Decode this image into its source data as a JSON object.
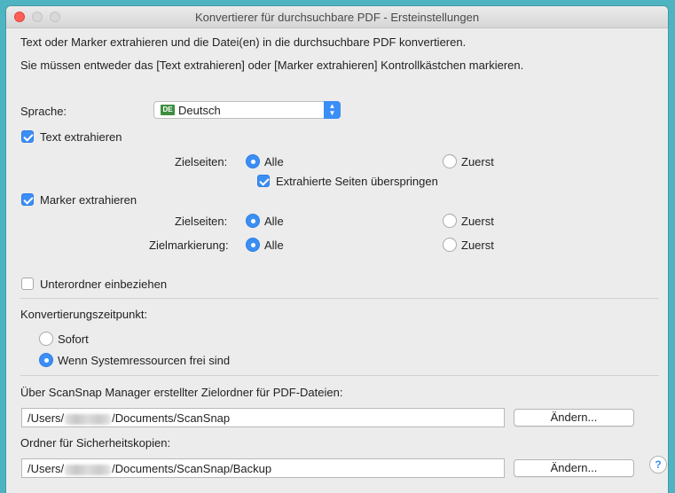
{
  "window": {
    "title": "Konvertierer für durchsuchbare PDF - Ersteinstellungen"
  },
  "intro": {
    "line1": "Text oder Marker extrahieren und die Datei(en) in die durchsuchbare PDF konvertieren.",
    "line2": "Sie müssen entweder das [Text extrahieren] oder [Marker extrahieren] Kontrollkästchen markieren."
  },
  "language": {
    "label": "Sprache:",
    "flag": "DE",
    "value": "Deutsch"
  },
  "text_extract": {
    "label": "Text extrahieren",
    "checked": true,
    "target_label": "Zielseiten:",
    "opt_all": "Alle",
    "opt_first": "Zuerst",
    "skip_label": "Extrahierte Seiten überspringen"
  },
  "marker_extract": {
    "label": "Marker extrahieren",
    "checked": true,
    "target_label": "Zielseiten:",
    "opt_all": "Alle",
    "opt_first": "Zuerst",
    "marker_label": "Zielmarkierung:",
    "marker_all": "Alle",
    "marker_first": "Zuerst"
  },
  "subfolders": {
    "label": "Unterordner einbeziehen",
    "checked": false
  },
  "timing": {
    "label": "Konvertierungszeitpunkt:",
    "opt_now": "Sofort",
    "opt_idle": "Wenn Systemressourcen frei sind"
  },
  "target_folder": {
    "label": "Über ScanSnap Manager erstellter Zielordner für PDF-Dateien:",
    "path_prefix": "/Users/",
    "path_suffix": "/Documents/ScanSnap",
    "button": "Ändern..."
  },
  "backup_folder": {
    "label": "Ordner für Sicherheitskopien:",
    "path_prefix": "/Users/",
    "path_suffix": "/Documents/ScanSnap/Backup",
    "button": "Ändern..."
  },
  "help": {
    "glyph": "?"
  },
  "colors": {
    "accent": "#3b8ef5",
    "background": "#4fb4c2",
    "window": "#ececec"
  }
}
